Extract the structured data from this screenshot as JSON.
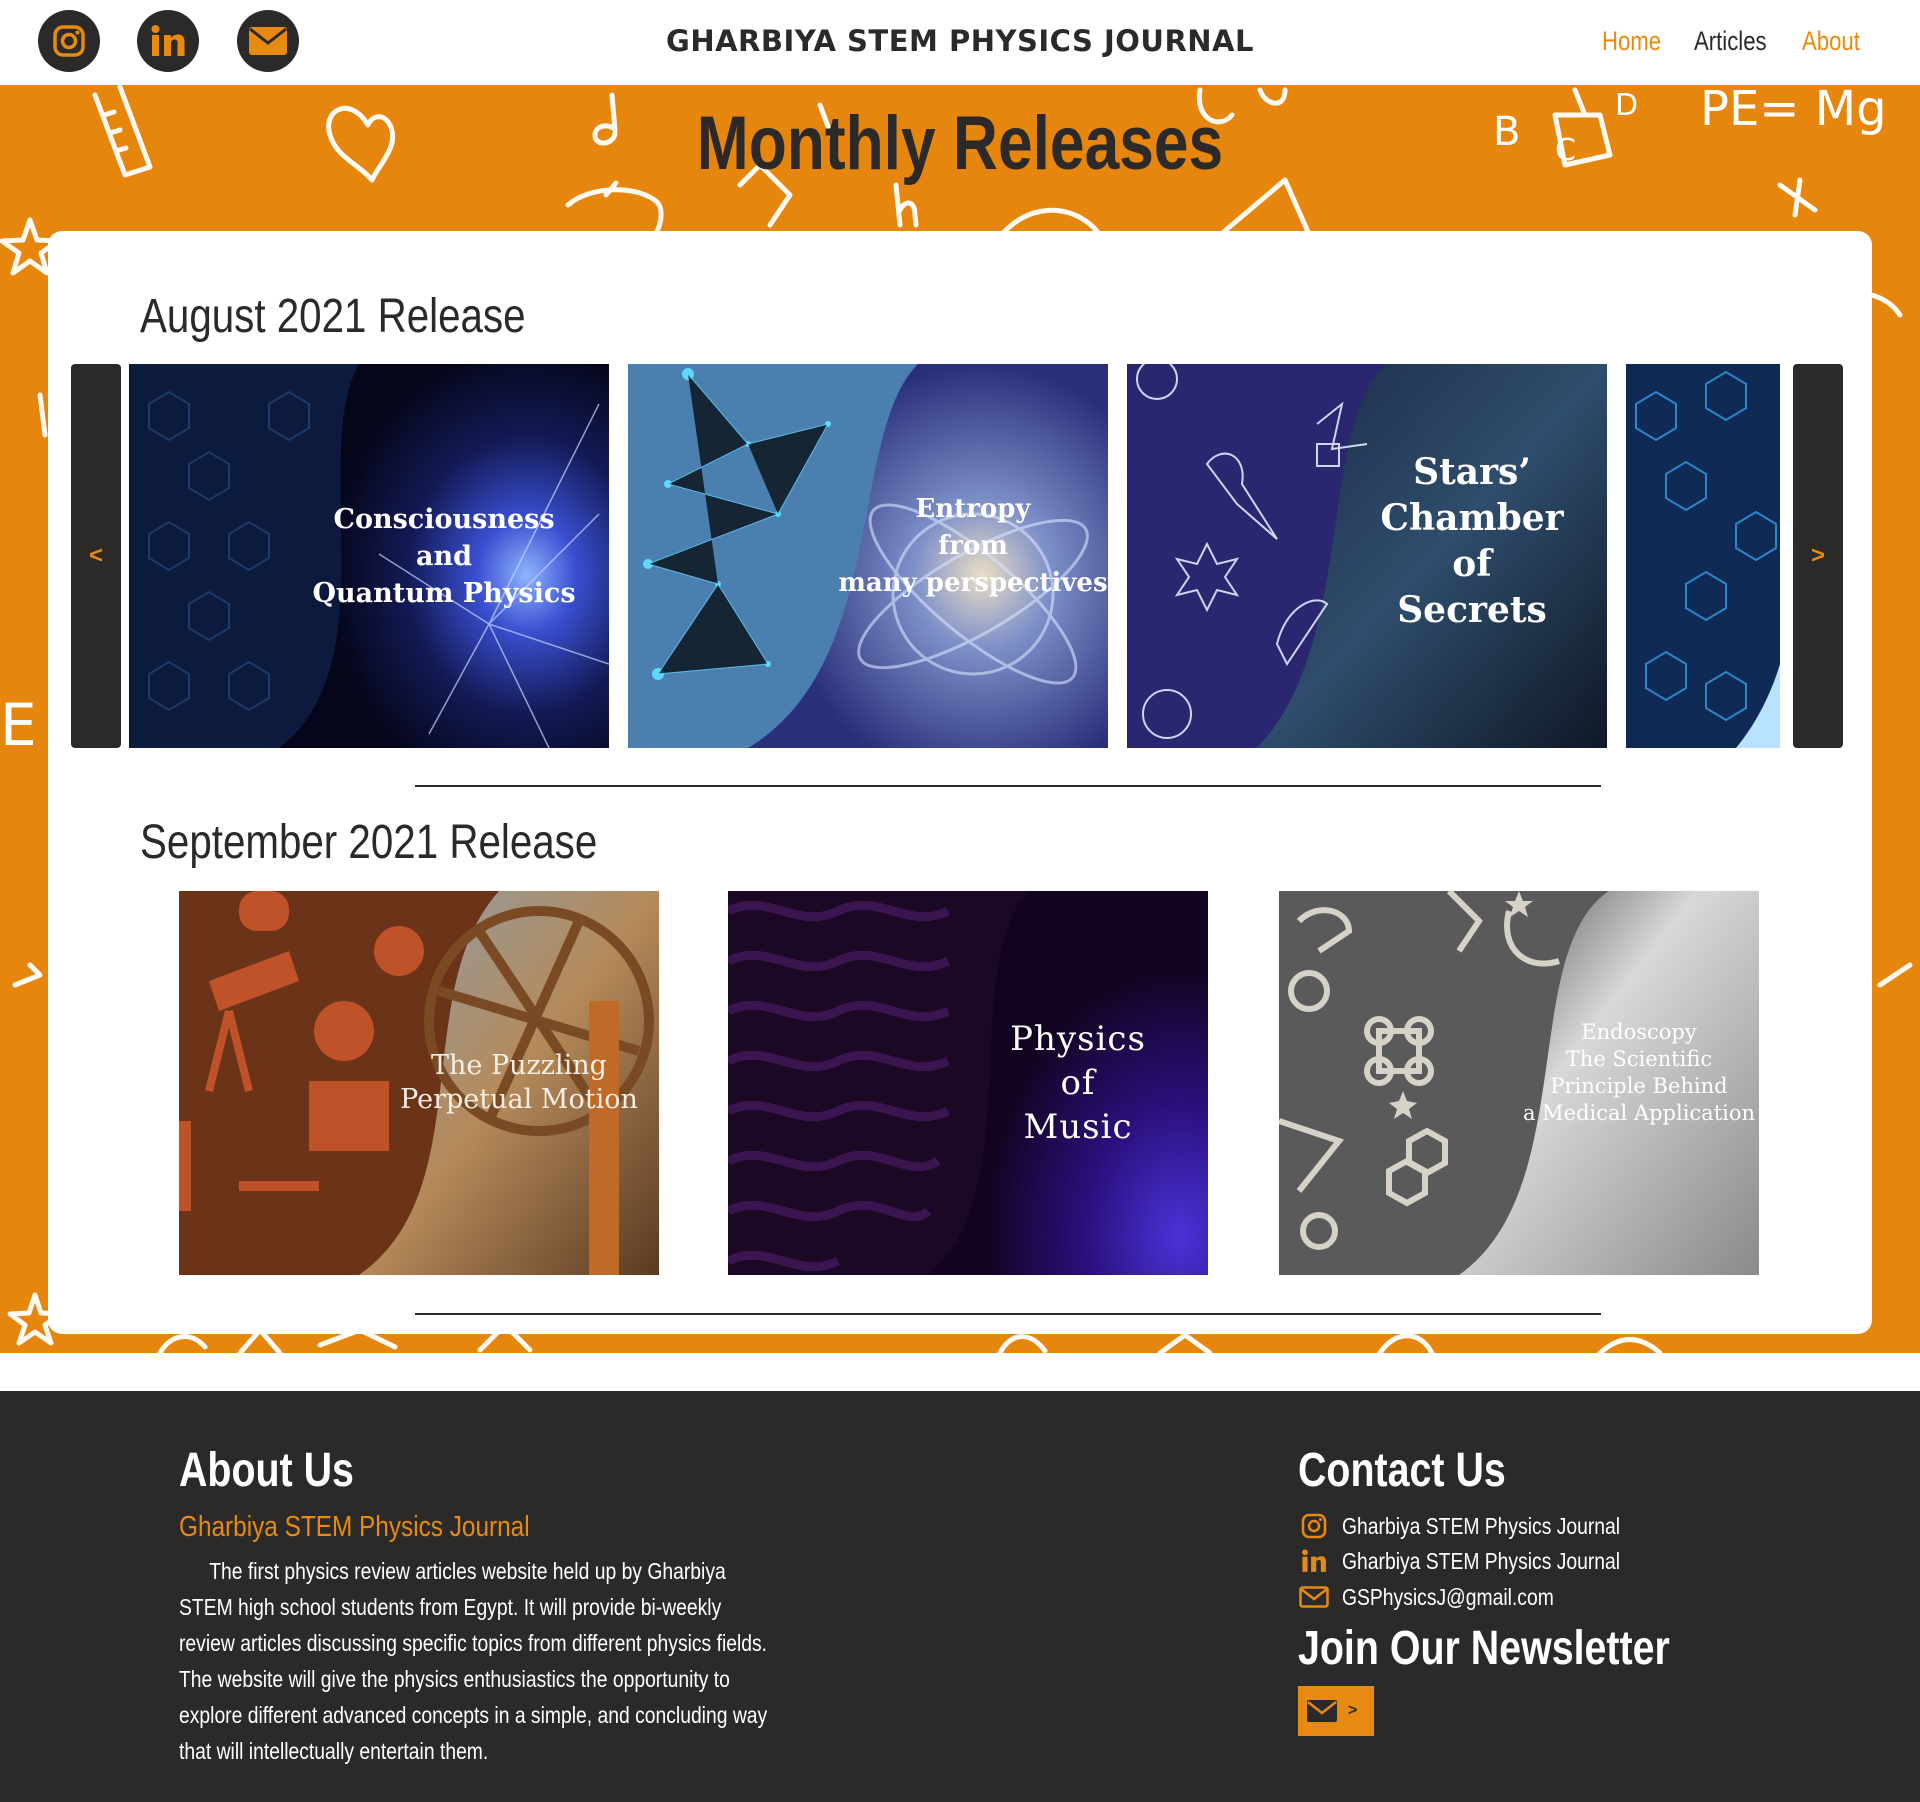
{
  "header": {
    "site_title": "GHARBIYA STEM PHYSICS JOURNAL",
    "social_icons": [
      "instagram-icon",
      "linkedin-icon",
      "mail-icon"
    ],
    "nav": [
      {
        "label": "Home",
        "active": true
      },
      {
        "label": "Articles",
        "active": false
      },
      {
        "label": "About",
        "active": false
      }
    ]
  },
  "hero": {
    "heading": "Monthly Releases",
    "doodle_text": [
      "PE= Mg",
      "B",
      "C",
      "D",
      "E"
    ]
  },
  "releases": {
    "august": {
      "title": "August 2021 Release",
      "prev_label": "<",
      "next_label": ">",
      "tiles": [
        {
          "text": "Consciousness\nand\nQuantum Physics"
        },
        {
          "text": "Entropy\nfrom\nmany perspectives"
        },
        {
          "text": "Stars’\nChamber\nof\nSecrets"
        },
        {
          "text": ""
        }
      ]
    },
    "september": {
      "title": "September 2021 Release",
      "tiles": [
        {
          "text": "The Puzzling\nPerpetual Motion"
        },
        {
          "text": "Physics\nof\nMusic"
        },
        {
          "text": "Endoscopy\nThe Scientific\nPrinciple Behind\na Medical Application"
        }
      ]
    }
  },
  "footer": {
    "about": {
      "heading": "About Us",
      "subtitle": "Gharbiya STEM Physics Journal",
      "description": "The first physics review articles website held up by Gharbiya STEM high school students from Egypt. It will provide bi-weekly review articles discussing specific topics from different physics fields. The website will give the physics enthusiastics the opportunity to explore different advanced concepts in a simple, and concluding way that will intellectually entertain them."
    },
    "contact": {
      "heading": "Contact Us",
      "items": [
        {
          "icon": "instagram-icon",
          "text": "Gharbiya STEM Physics Journal"
        },
        {
          "icon": "linkedin-icon",
          "text": "Gharbiya STEM Physics Journal"
        },
        {
          "icon": "mail-icon",
          "text": "GSPhysicsJ@gmail.com"
        }
      ]
    },
    "newsletter": {
      "heading": "Join Our Newsletter",
      "arrow": ">"
    }
  },
  "colors": {
    "accent": "#e68a10",
    "dark": "#2b2a28",
    "band": "#e6860c",
    "white": "#ffffff"
  }
}
